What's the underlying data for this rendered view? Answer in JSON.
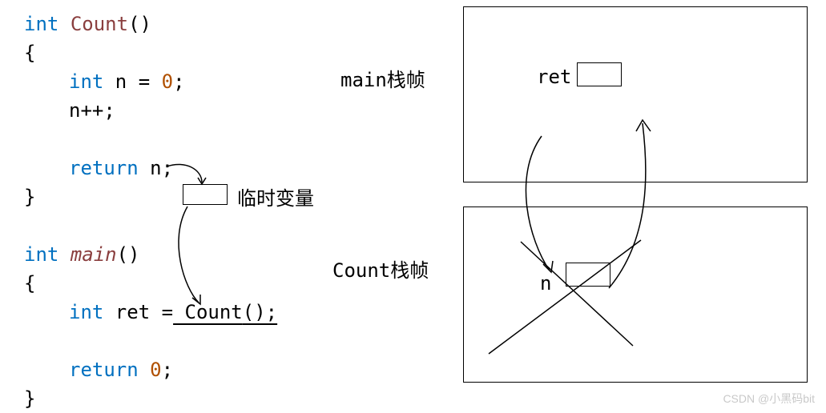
{
  "code": {
    "fn1_sig_int": "int",
    "fn1_sig_name": "Count",
    "fn1_sig_parens": "()",
    "brace_open": "{",
    "brace_close": "}",
    "line_decl_int": "int",
    "line_decl_n": " n ",
    "line_decl_eq": "=",
    "line_decl_val": " 0",
    "semi": ";",
    "line_incr": "n++;",
    "line_return_n_kw": "return",
    "line_return_n_rest": " n;",
    "fn2_sig_int": "int",
    "fn2_sig_name": "main",
    "fn2_sig_parens": "()",
    "line_ret_int": "int",
    "line_ret_name": " ret ",
    "line_ret_eq": "=",
    "line_ret_call": " Count",
    "line_ret_call_parens": "();",
    "line_return0_kw": "return",
    "line_return0_rest": " 0",
    "line_return0_semi": ";"
  },
  "labels": {
    "temp_var": "临时变量",
    "main_frame": "main栈帧",
    "count_frame": "Count栈帧",
    "ret": "ret",
    "n": "n"
  },
  "watermark": "CSDN @小黑码bit"
}
